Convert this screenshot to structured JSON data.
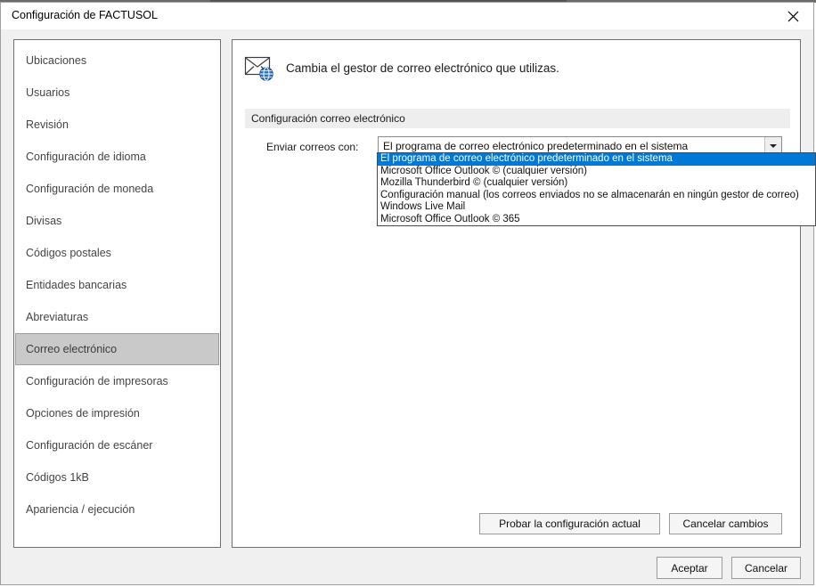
{
  "window": {
    "title": "Configuración de FACTUSOL",
    "close_icon": "close-icon"
  },
  "sidebar": {
    "items": [
      {
        "label": "Ubicaciones",
        "selected": false
      },
      {
        "label": "Usuarios",
        "selected": false
      },
      {
        "label": "Revisión",
        "selected": false
      },
      {
        "label": "Configuración de idioma",
        "selected": false
      },
      {
        "label": "Configuración de moneda",
        "selected": false
      },
      {
        "label": "Divisas",
        "selected": false
      },
      {
        "label": "Códigos postales",
        "selected": false
      },
      {
        "label": "Entidades bancarias",
        "selected": false
      },
      {
        "label": "Abreviaturas",
        "selected": false
      },
      {
        "label": "Correo electrónico",
        "selected": true
      },
      {
        "label": "Configuración de impresoras",
        "selected": false
      },
      {
        "label": "Opciones de impresión",
        "selected": false
      },
      {
        "label": "Configuración de escáner",
        "selected": false
      },
      {
        "label": "Códigos 1kB",
        "selected": false
      },
      {
        "label": "Apariencia / ejecución",
        "selected": false
      }
    ]
  },
  "main": {
    "header_icon": "email-globe-icon",
    "header_text": "Cambia el gestor de correo electrónico que utilizas.",
    "section_title": "Configuración correo electrónico",
    "field": {
      "label": "Enviar correos con:",
      "selected_value": "El programa de correo electrónico predeterminado en el sistema",
      "arrow_icon": "chevron-down-icon",
      "expanded": true,
      "options": [
        "El programa de correo electrónico predeterminado en el sistema",
        "Microsoft Office Outlook © (cualquier versión)",
        "Mozilla Thunderbird © (cualquier versión)",
        "Configuración manual (los correos enviados no se almacenarán en ningún gestor de correo)",
        "Windows Live Mail",
        "Microsoft Office Outlook © 365"
      ],
      "highlighted_index": 0
    },
    "buttons": {
      "test": "Probar la configuración actual",
      "cancel_changes": "Cancelar cambios"
    }
  },
  "footer": {
    "accept": "Aceptar",
    "cancel": "Cancelar"
  },
  "colors": {
    "highlight": "#0078d7",
    "selected_sidebar": "#c9c9c9",
    "dialog_bg": "#f0f0f0",
    "section_bar": "#eeeeee"
  }
}
